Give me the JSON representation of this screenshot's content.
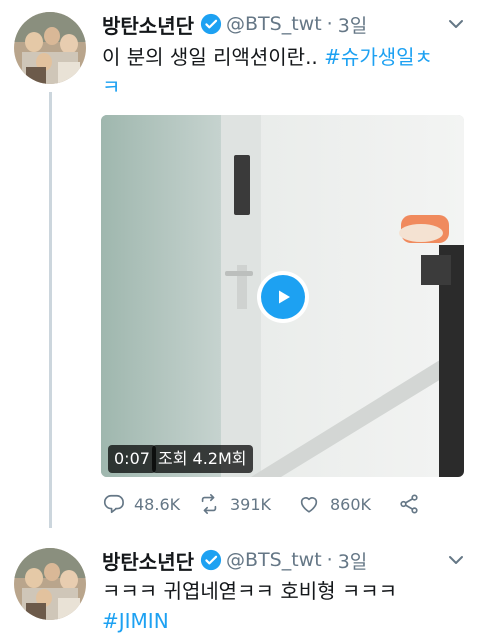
{
  "tweets": [
    {
      "author_name": "방탄소년단",
      "handle": "@BTS_twt",
      "separator": "·",
      "time": "3일",
      "text_plain": "이 분의 생일 리액션이란.. ",
      "text_hashtag": "#슈가생일ㅊ",
      "text_line2": "ㅋ",
      "video": {
        "duration": "0:07",
        "views": "조회 4.2M회"
      },
      "stats": {
        "replies": "48.6K",
        "retweets": "391K",
        "likes": "860K"
      }
    },
    {
      "author_name": "방탄소년단",
      "handle": "@BTS_twt",
      "separator": "·",
      "time": "3일",
      "text_plain": "ㅋㅋㅋ 귀엽네엳ㅋㅋ 호비형 ㅋㅋㅋ",
      "text_hashtag": "#JIMIN"
    }
  ],
  "colors": {
    "accent": "#1da1f2",
    "muted": "#657786",
    "text": "#14171a",
    "thread_line": "#ccd6dd"
  },
  "icons": [
    "verified-badge-icon",
    "chevron-down-icon",
    "play-icon",
    "reply-icon",
    "retweet-icon",
    "like-icon",
    "share-icon"
  ]
}
